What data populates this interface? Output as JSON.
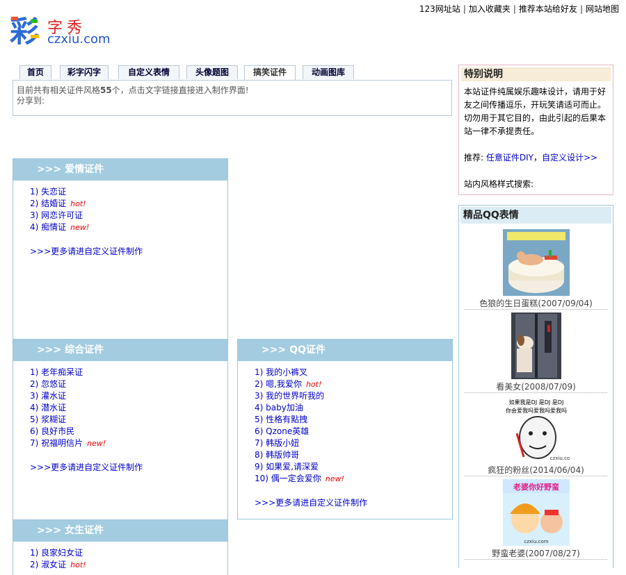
{
  "toplinks": [
    "123网址站",
    "加入收藏夹",
    "推荐本站给好友",
    "网站地图"
  ],
  "logo": {
    "cai": "彩",
    "zixiu": "字秀",
    "domain": "czxiu.com"
  },
  "tabs": [
    "首页",
    "彩字闪字",
    "自定义表情",
    "头像题图",
    "搞笑证件",
    "动画图库"
  ],
  "info": {
    "line1_pre": "目前共有相关证件风格",
    "count": "55",
    "line1_post": "个，点击文字链接直接进入制作界面!",
    "line2": "分享到:"
  },
  "panels": {
    "love": {
      "title": ">>> 爱情证件",
      "items": [
        {
          "text": "1) 失恋证",
          "tag": ""
        },
        {
          "text": "2) 结婚证",
          "tag": "hot!"
        },
        {
          "text": "3) 网恋许可证",
          "tag": ""
        },
        {
          "text": "4) 痴情证",
          "tag": "new!"
        }
      ],
      "more": ">>>更多请进自定义证件制作"
    },
    "general": {
      "title": ">>> 综合证件",
      "items": [
        {
          "text": "1) 老年痴呆证",
          "tag": ""
        },
        {
          "text": "2) 忽悠证",
          "tag": ""
        },
        {
          "text": "3) 灌水证",
          "tag": ""
        },
        {
          "text": "4) 潜水证",
          "tag": ""
        },
        {
          "text": "5) 浆糊证",
          "tag": ""
        },
        {
          "text": "6) 良好市民",
          "tag": ""
        },
        {
          "text": "7) 祝福明信片",
          "tag": "new!"
        }
      ],
      "more": ">>>更多请进自定义证件制作"
    },
    "qq": {
      "title": ">>> QQ证件",
      "items": [
        {
          "text": "1) 我的小裤叉",
          "tag": ""
        },
        {
          "text": "2) 嗯,我爱你",
          "tag": "hot!"
        },
        {
          "text": "3) 我的世界听我的",
          "tag": ""
        },
        {
          "text": "4) baby加油",
          "tag": ""
        },
        {
          "text": "5) 性格有點拽",
          "tag": ""
        },
        {
          "text": "6) Qzone英雄",
          "tag": ""
        },
        {
          "text": "7) 韩版小妞",
          "tag": ""
        },
        {
          "text": "8) 韩版帅哥",
          "tag": ""
        },
        {
          "text": "9) 如果爱,请深爱",
          "tag": ""
        },
        {
          "text": "10) 偶一定会爱你",
          "tag": "new!"
        }
      ],
      "more": ">>>更多请进自定义证件制作"
    },
    "girl": {
      "title": ">>> 女生证件",
      "items": [
        {
          "text": "1) 良家妇女证",
          "tag": ""
        },
        {
          "text": "2) 淑女证",
          "tag": "hot!"
        }
      ]
    }
  },
  "notice": {
    "title": "特别说明",
    "body": "本站证件纯属娱乐趣味设计，请用于好友之间传播逗乐，开玩笑请适可而止。切勿用于其它目的，由此引起的后果本站一律不承提责任。",
    "recommend_label": "推荐: ",
    "recommend_link1": "任意证件DIY",
    "recommend_sep": "，",
    "recommend_link2": "自定义设计>>",
    "search_label": "站内风格样式搜索:"
  },
  "qq_faces": {
    "title": "精品QQ表情",
    "items": [
      {
        "caption": "色狼的生日蛋糕(2007/09/04)"
      },
      {
        "caption": "看美女(2008/07/09)"
      },
      {
        "caption": "疯狂的粉丝(2014/06/04)",
        "img_text1": "如果我是DJ 是DJ 是DJ",
        "img_text2": "你会爱我吗爱我吗爱我吗",
        "img_watermark": "czxiu.co"
      },
      {
        "caption": "野蛮老婆(2007/08/27)",
        "img_text1": "老婆你好野蛮",
        "img_watermark": "czxiu.com"
      }
    ]
  },
  "colors": {
    "panel_header": "#a3cce0",
    "link": "#0000cc",
    "tag": "#ee0000"
  }
}
